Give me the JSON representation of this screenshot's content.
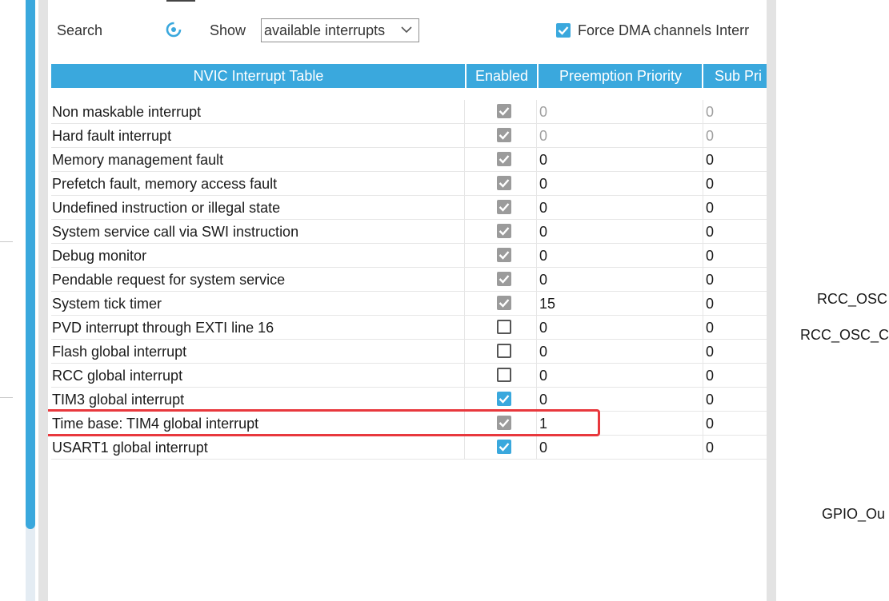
{
  "toolbar": {
    "search_label": "Search",
    "show_label": "Show",
    "show_select_value": "available interrupts",
    "force_dma_label": "Force DMA channels Interr",
    "force_dma_checked": true
  },
  "table": {
    "headers": [
      "NVIC Interrupt Table",
      "Enabled",
      "Preemption Priority",
      "Sub Pri"
    ],
    "rows": [
      {
        "name": "Non maskable interrupt",
        "enabled": "checked-locked",
        "preemption": "0",
        "sub": "0",
        "dim": true
      },
      {
        "name": "Hard fault interrupt",
        "enabled": "checked-locked",
        "preemption": "0",
        "sub": "0",
        "dim": true
      },
      {
        "name": "Memory management fault",
        "enabled": "checked-locked",
        "preemption": "0",
        "sub": "0",
        "dim": false
      },
      {
        "name": "Prefetch fault, memory access fault",
        "enabled": "checked-locked",
        "preemption": "0",
        "sub": "0",
        "dim": false
      },
      {
        "name": "Undefined instruction or illegal state",
        "enabled": "checked-locked",
        "preemption": "0",
        "sub": "0",
        "dim": false
      },
      {
        "name": "System service call via SWI instruction",
        "enabled": "checked-locked",
        "preemption": "0",
        "sub": "0",
        "dim": false
      },
      {
        "name": "Debug monitor",
        "enabled": "checked-locked",
        "preemption": "0",
        "sub": "0",
        "dim": false
      },
      {
        "name": "Pendable request for system service",
        "enabled": "checked-locked",
        "preemption": "0",
        "sub": "0",
        "dim": false
      },
      {
        "name": "System tick timer",
        "enabled": "checked-locked",
        "preemption": "15",
        "sub": "0",
        "dim": false
      },
      {
        "name": "PVD interrupt through EXTI line 16",
        "enabled": "unchecked",
        "preemption": "0",
        "sub": "0",
        "dim": false
      },
      {
        "name": "Flash global interrupt",
        "enabled": "unchecked",
        "preemption": "0",
        "sub": "0",
        "dim": false
      },
      {
        "name": "RCC global interrupt",
        "enabled": "unchecked",
        "preemption": "0",
        "sub": "0",
        "dim": false
      },
      {
        "name": "TIM3 global interrupt",
        "enabled": "checked",
        "preemption": "0",
        "sub": "0",
        "dim": false
      },
      {
        "name": "Time base: TIM4 global interrupt",
        "enabled": "checked-locked",
        "preemption": "1",
        "sub": "0",
        "dim": false
      },
      {
        "name": "USART1 global interrupt",
        "enabled": "checked",
        "preemption": "0",
        "sub": "0",
        "dim": false
      }
    ]
  },
  "pin_labels": [
    "RCC_OSC",
    "RCC_OSC_C",
    "GPIO_Ou"
  ],
  "colors": {
    "accent": "#3aa8dd",
    "highlight": "#e8383d",
    "locked_checkbox": "#9b9b9b"
  },
  "icons": {
    "refresh": "refresh-icon",
    "dropdown": "chevron-down-icon",
    "checkbox": "checkbox-icon"
  }
}
